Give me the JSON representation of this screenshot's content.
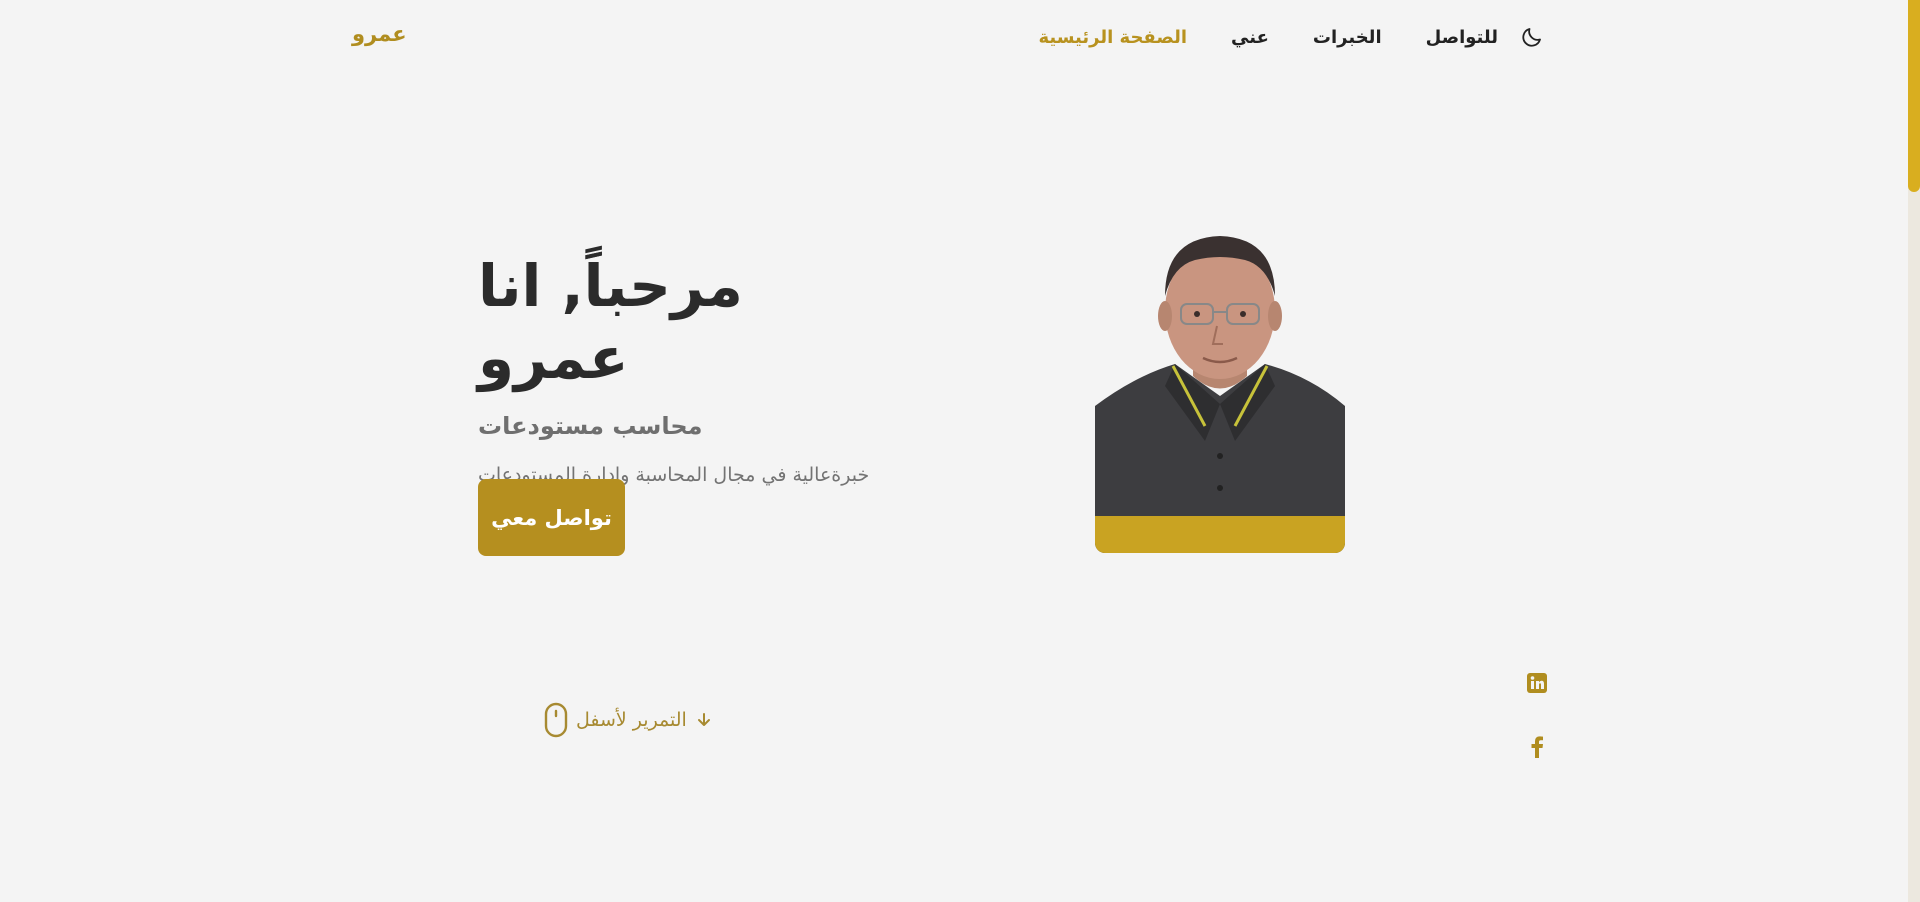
{
  "header": {
    "logo": "عمرو",
    "nav": {
      "home": "الصفحة الرئيسية",
      "about": "عني",
      "experience": "الخبرات",
      "contact": "للتواصل"
    },
    "theme_toggle_icon": "moon-icon"
  },
  "hero": {
    "title": "مرحباًَ, انا عمرو",
    "subtitle": "محاسب مستودعات",
    "description": "خبرةعالية في مجال المحاسبة وإدارة المستودعات",
    "button_label": "تواصل معي",
    "photo": "profile-photo"
  },
  "scroll": {
    "label": "التمرير لأسفل",
    "icons": [
      "mouse-icon",
      "arrow-down-icon"
    ]
  },
  "social": {
    "icons": [
      "linkedin-icon",
      "facebook-icon"
    ]
  },
  "colors": {
    "accent": "#b58f1f",
    "background": "#f4f4f4",
    "text": "#2b2b2b",
    "muted": "#737373"
  }
}
